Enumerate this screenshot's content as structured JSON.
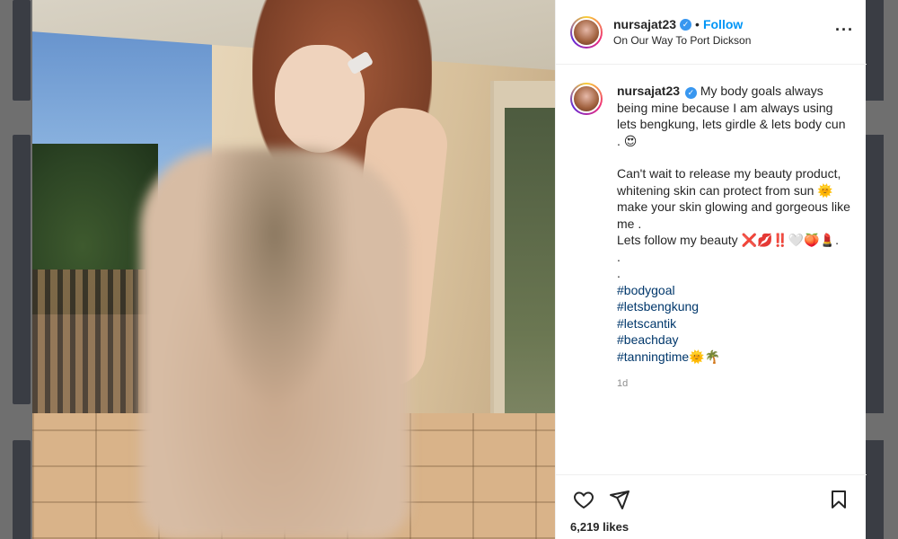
{
  "post": {
    "username": "nursajat23",
    "follow_label": "Follow",
    "location": "On Our Way To Port Dickson",
    "caption_lines": [
      "My body goals always being mine because I am always using lets bengkung, lets girdle & lets body cun . 😍",
      "Can't wait to release my beauty product, whitening skin can protect from sun 🌞 make your skin glowing and gorgeous like me .",
      "Lets follow my beauty ❌💋‼️🤍🍑💄."
    ],
    "dots": [
      ".",
      "."
    ],
    "hashtags": [
      "#bodygoal",
      "#letsbengkung",
      "#letscantik",
      "#beachday",
      "#tanningtime🌞🌴"
    ],
    "time_ago": "1d",
    "likes": "6,219 likes"
  },
  "icons": {
    "verified": "verified-badge-icon",
    "more": "more-options-icon",
    "like": "heart-icon",
    "share": "paper-plane-icon",
    "save": "bookmark-icon"
  },
  "colors": {
    "accent": "#0095f6",
    "verified": "#3897f0",
    "hashtag": "#00376b"
  }
}
